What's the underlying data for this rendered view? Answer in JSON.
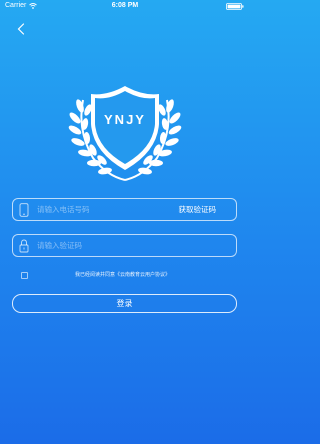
{
  "status_bar": {
    "carrier": "Carrier",
    "time": "6:08 PM"
  },
  "logo": {
    "text": "YNJY"
  },
  "form": {
    "phone_placeholder": "请输入电话号码",
    "get_code_label": "获取验证码",
    "code_placeholder": "请输入验证码",
    "agreement_text": "我已经阅读并同意《云南教育云用户协议》",
    "login_label": "登录"
  },
  "colors": {
    "background_top": "#25a9f2",
    "background_bottom": "#1b6ce8",
    "text": "#ffffff"
  }
}
